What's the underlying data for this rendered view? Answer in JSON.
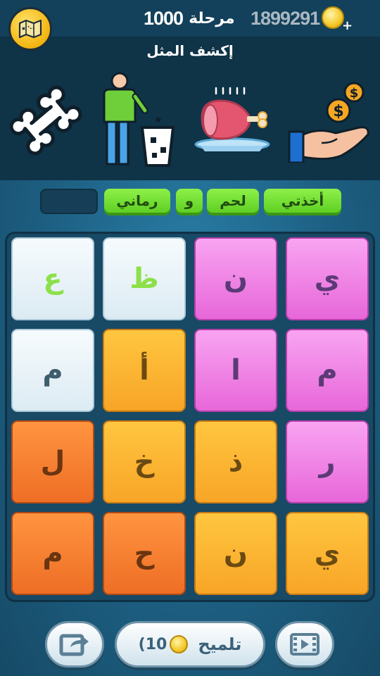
{
  "header": {
    "map_icon": "map-icon",
    "level_label": "مرحلة",
    "level_number": "1000",
    "coins": "1899291",
    "coin_icon": "coin-icon",
    "add_icon": "plus-icon"
  },
  "puzzle": {
    "title": "إكشف المثل",
    "pictures": [
      "bone-icon",
      "person-trash-icon",
      "meat-plate-icon",
      "hand-money-icon"
    ]
  },
  "answer": {
    "words": [
      "أخذتي",
      "لحم",
      "و",
      "رماني"
    ]
  },
  "grid": {
    "rows": [
      [
        {
          "letter": "ي",
          "color": "pink"
        },
        {
          "letter": "ن",
          "color": "pink"
        },
        {
          "letter": "ظ",
          "color": "white"
        },
        {
          "letter": "ع",
          "color": "white"
        }
      ],
      [
        {
          "letter": "م",
          "color": "pink"
        },
        {
          "letter": "ا",
          "color": "pink"
        },
        {
          "letter": "أ",
          "color": "orange"
        },
        {
          "letter": "م",
          "color": "white"
        }
      ],
      [
        {
          "letter": "ر",
          "color": "pink"
        },
        {
          "letter": "ذ",
          "color": "orange"
        },
        {
          "letter": "خ",
          "color": "orange"
        },
        {
          "letter": "ل",
          "color": "dark-orange"
        }
      ],
      [
        {
          "letter": "ي",
          "color": "orange"
        },
        {
          "letter": "ن",
          "color": "orange"
        },
        {
          "letter": "ح",
          "color": "dark-orange"
        },
        {
          "letter": "م",
          "color": "dark-orange"
        }
      ]
    ]
  },
  "footer": {
    "hint_label": "تلميح",
    "hint_cost": "(10",
    "share_icon": "share-icon",
    "video_icon": "video-icon"
  },
  "colors": {
    "pink": "#f08ae8",
    "orange": "#fbb431",
    "dark_orange": "#f47d30",
    "white": "#eaf4f8",
    "chip_green": "#6fdc30",
    "background": "#1d5f82"
  }
}
